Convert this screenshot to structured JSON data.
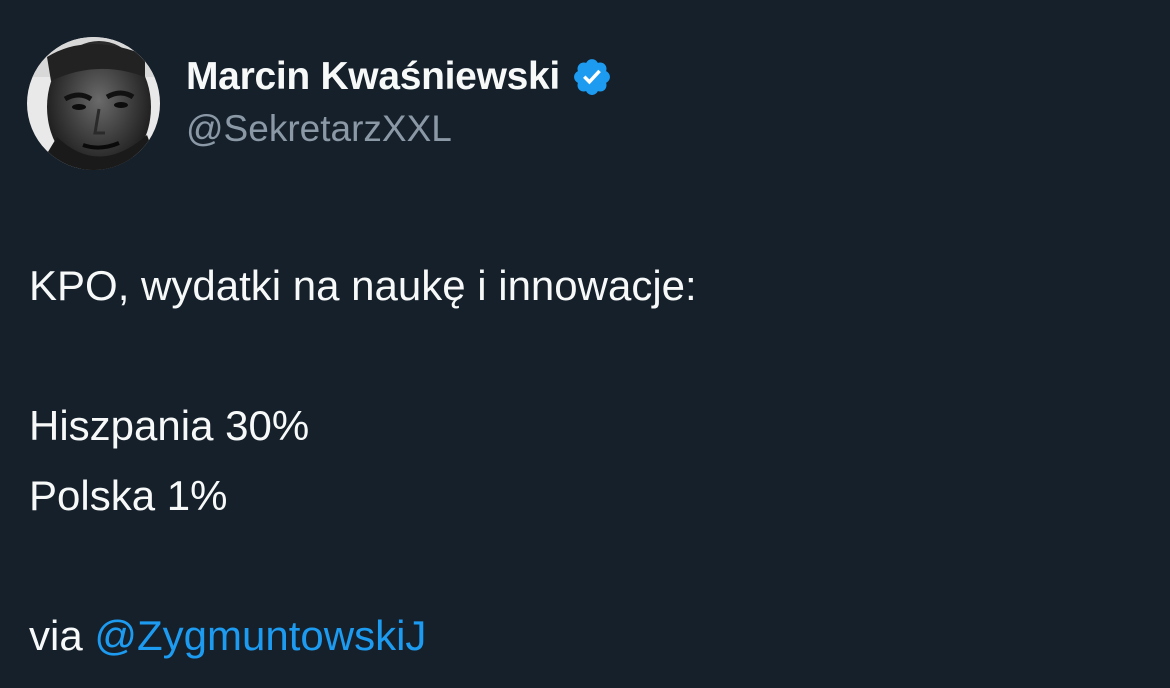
{
  "author": {
    "display_name": "Marcin Kwaśniewski",
    "handle": "@SekretarzXXL",
    "verified": true,
    "avatar_icon": "user-avatar-photo",
    "verified_icon": "verified-badge-icon"
  },
  "tweet": {
    "line1": "KPO, wydatki na naukę i innowacje:",
    "line2": "Hiszpania 30%",
    "line3": "Polska 1%",
    "via_prefix": "via",
    "via_mention": "@ZygmuntowskiJ"
  },
  "colors": {
    "background": "#15202b",
    "text_primary": "#f7f9f9",
    "text_secondary": "#8b98a5",
    "accent": "#1d9bf0"
  }
}
